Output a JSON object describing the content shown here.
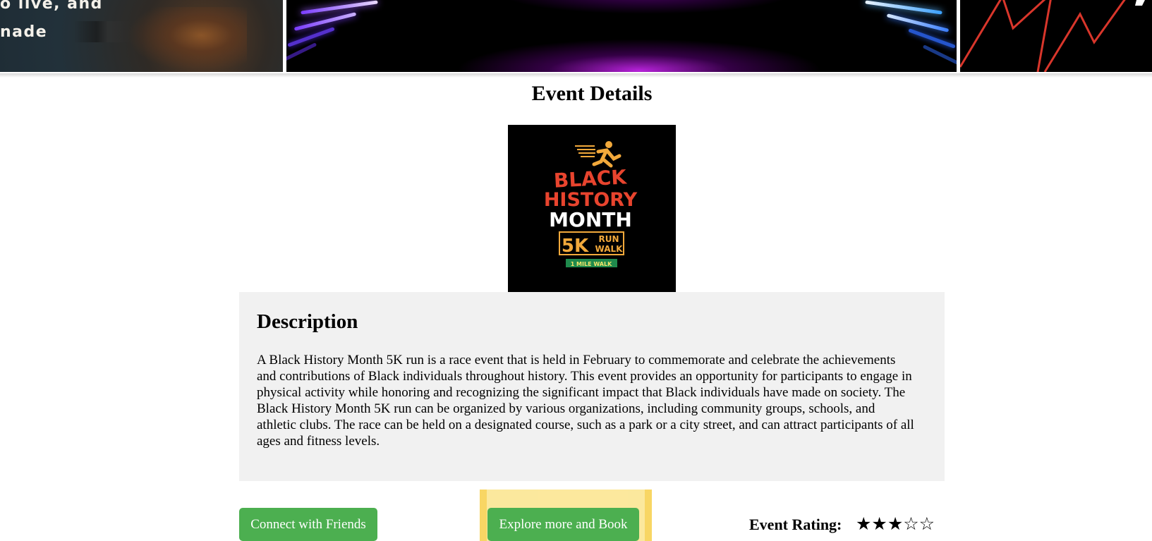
{
  "banner": {
    "card1_text_line1": "o live, and",
    "card1_text_line2": "nade"
  },
  "event": {
    "title": "Event Details",
    "poster": {
      "line1": "BLACK",
      "line2": "HISTORY",
      "line3": "MONTH",
      "distance": "5K",
      "run": "RUN",
      "walk": "WALK",
      "mile_walk": "1 MILE WALK"
    },
    "description_heading": "Description",
    "description_text": "A Black History Month 5K run is a race event that is held in February to commemorate and celebrate the achievements and contributions of Black individuals throughout history. This event provides an opportunity for participants to engage in physical activity while honoring and recognizing the significant impact that Black individuals have made on society. The Black History Month 5K run can be organized by various organizations, including community groups, schools, and athletic clubs. The race can be held on a designated course, such as a park or a city street, and can attract participants of all ages and fitness levels."
  },
  "actions": {
    "connect_label": "Connect with Friends",
    "explore_label": "Explore more and Book"
  },
  "rating": {
    "label": "Event Rating:",
    "value": 3,
    "max": 5,
    "stars_text": "★★★☆☆"
  },
  "colors": {
    "button_green": "#4caf50",
    "card_gray": "#f1f1f1",
    "highlight_yellow": "#fbe48c"
  }
}
